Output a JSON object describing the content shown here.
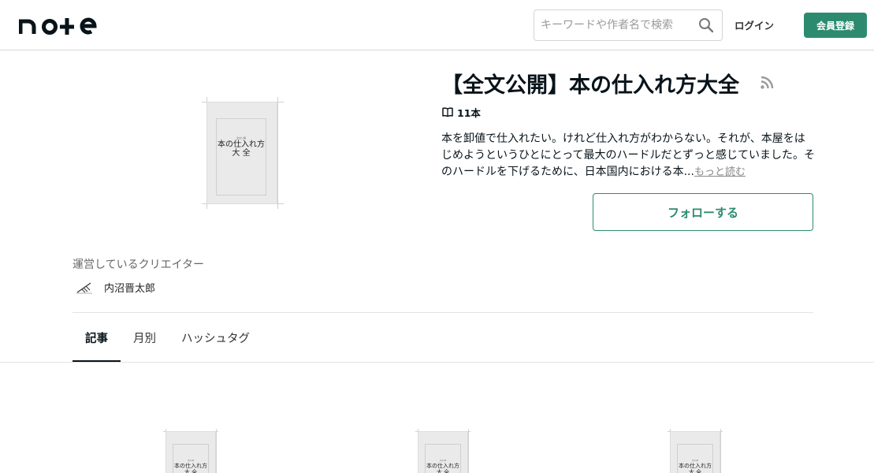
{
  "header": {
    "logo_text": "note",
    "search_placeholder": "キーワードや作者名で検索",
    "login_label": "ログイン",
    "signup_label": "会員登録",
    "accent_color": "#2c8b6e"
  },
  "magazine": {
    "cover_title_line1": "本の仕入れ方",
    "cover_title_line2": "大 全",
    "cover_tiny": "全文公開",
    "title": "【全文公開】本の仕入れ方大全",
    "article_count": "11本",
    "description": "本を卸値で仕入れたい。けれど仕入れ方がわからない。それが、本屋をはじめようというひとにとって最大のハードルだとずっと感じていました。そのハードルを下げるために、日本国内における本...",
    "more_label": "もっと読む",
    "follow_label": "フォローする"
  },
  "creators": {
    "label": "運営しているクリエイター",
    "items": [
      {
        "name": "内沼晋太郎"
      }
    ]
  },
  "tabs": [
    {
      "label": "記事",
      "active": true
    },
    {
      "label": "月別",
      "active": false
    },
    {
      "label": "ハッシュタグ",
      "active": false
    }
  ],
  "articles": [
    {
      "thumb_line1": "本の仕入れ方",
      "thumb_line2": "大 全",
      "thumb_tiny": "全文公開"
    },
    {
      "thumb_line1": "本の仕入れ方",
      "thumb_line2": "大 全",
      "thumb_tiny": "全文公開"
    },
    {
      "thumb_line1": "本の仕入れ方",
      "thumb_line2": "大 全",
      "thumb_tiny": "全文公開"
    }
  ]
}
